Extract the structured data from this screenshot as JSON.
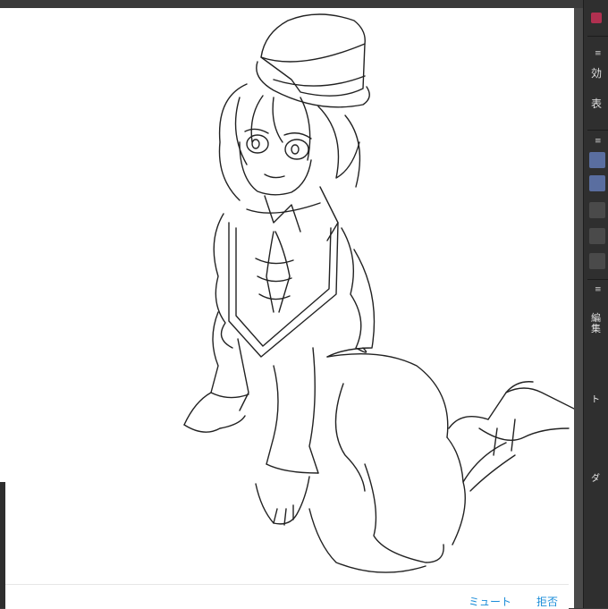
{
  "panel": {
    "label_effect": "効",
    "label_display": "表",
    "label_edit": "編集",
    "label_small_1": "ト",
    "label_small_2": "ダ",
    "accent_color": "#b03050",
    "active_color": "#5a6ea0"
  },
  "message_bar": {
    "mute_label": "ミュート",
    "reject_label": "拒否"
  },
  "canvas": {
    "background": "#ffffff",
    "content": "line-art illustration"
  }
}
